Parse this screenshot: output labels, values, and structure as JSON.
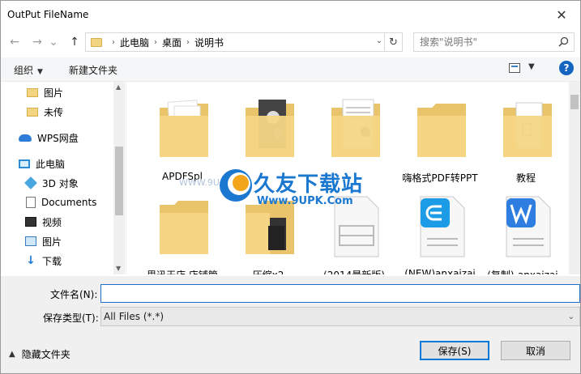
{
  "window": {
    "title": "OutPut FileName",
    "close_glyph": "✕"
  },
  "address": {
    "back_glyph": "←",
    "forward_glyph": "→",
    "recent_glyph": "⌄",
    "up_glyph": "↑",
    "separator": "›",
    "crumbs": [
      "此电脑",
      "桌面",
      "说明书"
    ],
    "dropdown_glyph": "⌄",
    "refresh_glyph": "↻"
  },
  "search": {
    "placeholder": "搜索\"说明书\""
  },
  "toolbar": {
    "organize_label": "组织",
    "organize_caret": "▼",
    "new_folder_label": "新建文件夹",
    "view_caret": "▼",
    "help_label": "?"
  },
  "nav": {
    "items": [
      {
        "label": "图片",
        "icon": "folder-icon"
      },
      {
        "label": "未传",
        "icon": "folder-icon"
      },
      {
        "label": "WPS网盘",
        "icon": "cloud-icon"
      },
      {
        "label": "此电脑",
        "icon": "computer-icon"
      },
      {
        "label": "3D 对象",
        "icon": "3d-objects-icon"
      },
      {
        "label": "Documents",
        "icon": "documents-icon"
      },
      {
        "label": "视频",
        "icon": "video-icon"
      },
      {
        "label": "图片",
        "icon": "pictures-icon"
      },
      {
        "label": "下载",
        "icon": "download-icon"
      }
    ],
    "scroll_up": "▲",
    "scroll_down": "▼"
  },
  "files": [
    {
      "label": "APDFSpl",
      "icon": "folder-with-documents-icon"
    },
    {
      "label": "",
      "icon": "folder-with-photos-icon"
    },
    {
      "label": "",
      "icon": "folder-with-document-icon"
    },
    {
      "label": "嗨格式PDF转PPT",
      "icon": "folder-icon"
    },
    {
      "label": "教程",
      "icon": "folder-with-file-icon"
    },
    {
      "label": "思迅天店 店铺管",
      "icon": "folder-icon"
    },
    {
      "label": "压缩x2",
      "icon": "folder-with-photos-icon"
    },
    {
      "label": "(2014最新版)",
      "icon": "document-file-icon"
    },
    {
      "label": "(NEW)anxaizai",
      "icon": "wps-doc-e-icon"
    },
    {
      "label": "(复制)-anxaizai -",
      "icon": "wps-writer-icon"
    }
  ],
  "watermark": {
    "title": "久友下载站",
    "url": "Www.9UPK.Com",
    "left_text": "WWW.9U"
  },
  "form": {
    "filename_label": "文件名(N):",
    "filename_value": "",
    "filetype_label": "保存类型(T):",
    "filetype_value": "All Files (*.*)",
    "select_caret": "⌄"
  },
  "footer": {
    "hide_caret": "▲",
    "hide_label": "隐藏文件夹",
    "save_label": "保存(S)",
    "cancel_label": "取消"
  },
  "colors": {
    "accent": "#0078d7",
    "folder": "#f3d480",
    "watermark": "#1a78d0"
  }
}
